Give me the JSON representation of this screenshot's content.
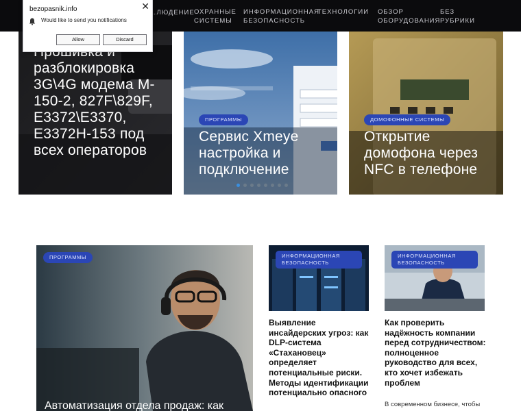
{
  "nav": {
    "items": [
      "…людение",
      "Охранные системы",
      "Информационная безопасность",
      "Технологии",
      "Обзор оборудования",
      "Без рубрики"
    ]
  },
  "notification": {
    "site": "bezopasnik.info",
    "message": "Would like to send you notifications",
    "allow_label": "Allow",
    "discard_label": "Discard",
    "close_glyph": "✕"
  },
  "slider": {
    "cards": [
      {
        "title": "Прошивка и разблокировка 3G\\4G модема M-150-2, 827F\\829F, E3372\\E3370, E3372H-153 под всех операторов"
      },
      {
        "badge": "Программы",
        "title": "Сервис Xmeye настройка и подключение"
      },
      {
        "badge": "Домофонные системы",
        "title": "Открытие домофона через NFC в телефоне"
      }
    ],
    "active_dot": 0,
    "dot_count": 8
  },
  "articles": {
    "featured": {
      "badge": "Программы",
      "title": "Автоматизация отдела продаж: как"
    },
    "second": {
      "badge": "Информационная безопасность",
      "title": "Выявление инсайдерских угроз: как DLP-система «Стахановец» определяет потенциальные риски. Методы идентификации потенциально опасного"
    },
    "third": {
      "badge": "Информационная безопасность",
      "title": "Как проверить надёжность компании перед сотрудничеством: полноценное руководство для всех, кто хочет избежать проблем",
      "excerpt": "В современном бизнесе, чтобы"
    }
  },
  "colors": {
    "header_bg": "#0b0b0d",
    "badge_bg": "#2b46b5",
    "active_dot": "#3a8fe0"
  }
}
